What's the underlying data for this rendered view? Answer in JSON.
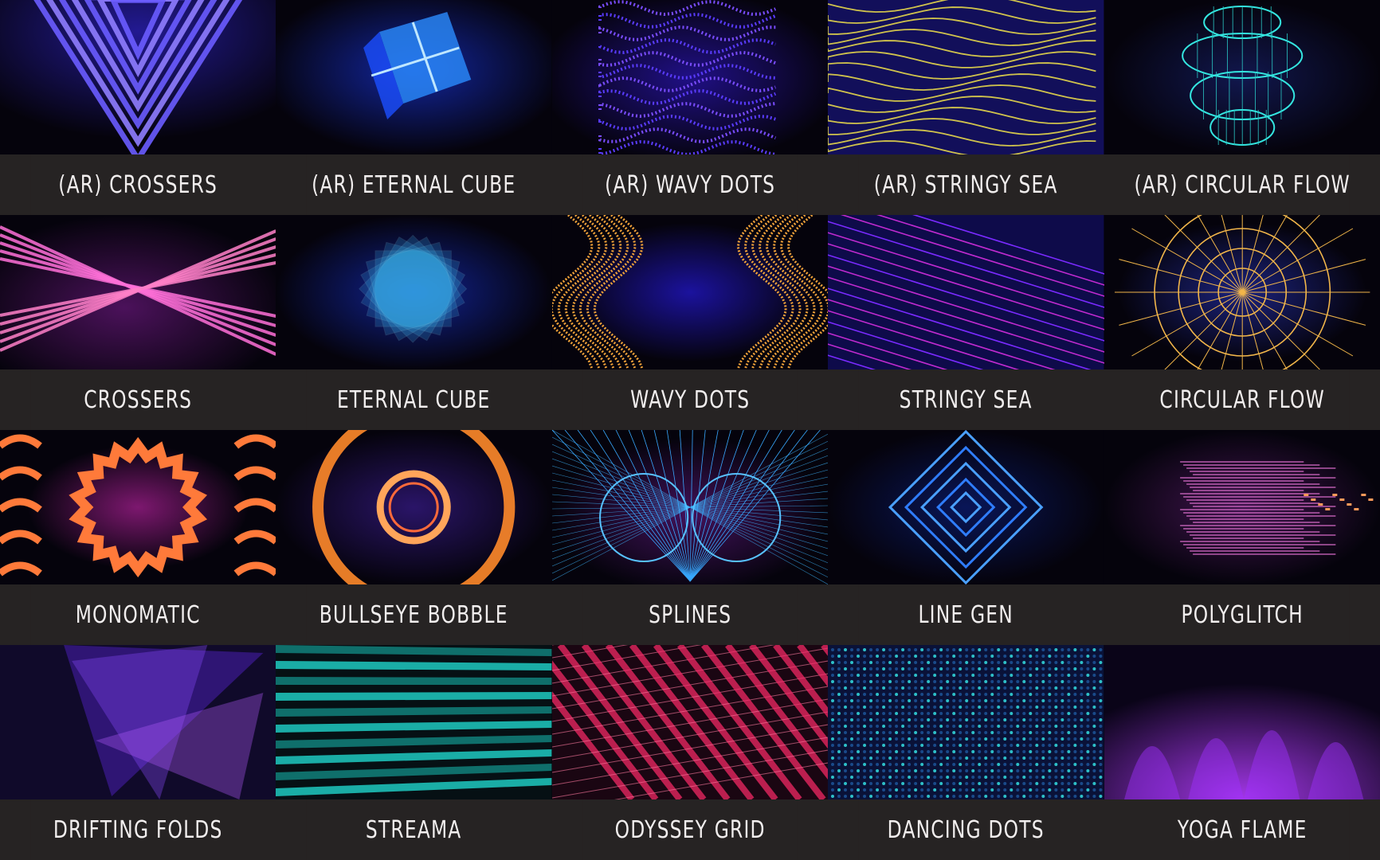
{
  "tiles": [
    {
      "label": "(AR) CROSSERS",
      "art": "crossers-ar",
      "accent": "#7d6cff"
    },
    {
      "label": "(AR) ETERNAL CUBE",
      "art": "cube-ar",
      "accent": "#2aa6ff"
    },
    {
      "label": "(AR) WAVY DOTS",
      "art": "wavy-dots-ar",
      "accent": "#5a35ff"
    },
    {
      "label": "(AR) STRINGY SEA",
      "art": "stringy-sea-ar",
      "accent": "#f2e34a"
    },
    {
      "label": "(AR) CIRCULAR FLOW",
      "art": "circular-flow-ar",
      "accent": "#34e6e0"
    },
    {
      "label": "CROSSERS",
      "art": "crossers",
      "accent": "#ff6fd8"
    },
    {
      "label": "ETERNAL CUBE",
      "art": "cube",
      "accent": "#4fd0ff"
    },
    {
      "label": "WAVY DOTS",
      "art": "wavy-dots",
      "accent": "#f0a23a"
    },
    {
      "label": "STRINGY SEA",
      "art": "stringy-sea",
      "accent": "#e03ad8"
    },
    {
      "label": "CIRCULAR FLOW",
      "art": "circular-flow",
      "accent": "#f2b64a"
    },
    {
      "label": "MONOMATIC",
      "art": "monomatic",
      "accent": "#ff7a3a"
    },
    {
      "label": "BULLSEYE BOBBLE",
      "art": "bullseye",
      "accent": "#ff8a2a"
    },
    {
      "label": "SPLINES",
      "art": "splines",
      "accent": "#39a8ff"
    },
    {
      "label": "LINE GEN",
      "art": "line-gen",
      "accent": "#2f7dff"
    },
    {
      "label": "POLYGLITCH",
      "art": "polyglitch",
      "accent": "#e070d0"
    },
    {
      "label": "DRIFTING FOLDS",
      "art": "drifting-folds",
      "accent": "#8a4bff"
    },
    {
      "label": "STREAMA",
      "art": "streama",
      "accent": "#1fc9c0"
    },
    {
      "label": "ODYSSEY GRID",
      "art": "odyssey-grid",
      "accent": "#ff2a6a"
    },
    {
      "label": "DANCING DOTS",
      "art": "dancing-dots",
      "accent": "#2ec0c8"
    },
    {
      "label": "YOGA FLAME",
      "art": "yoga-flame",
      "accent": "#b43cff"
    }
  ]
}
